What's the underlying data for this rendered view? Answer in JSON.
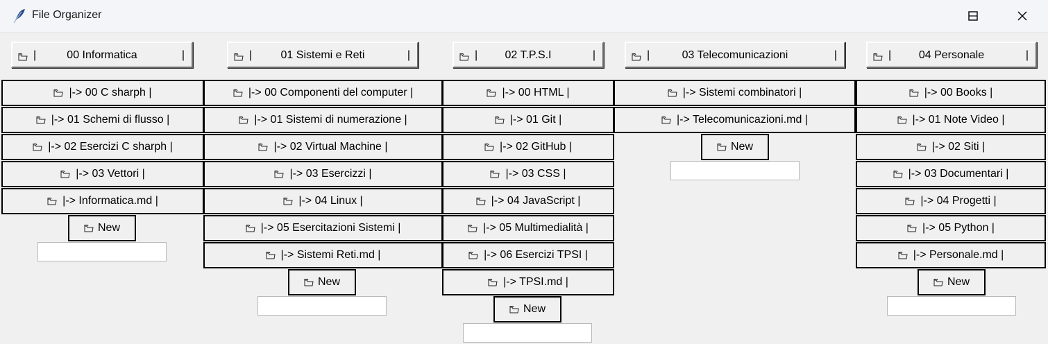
{
  "window": {
    "title": "File Organizer"
  },
  "columns": [
    {
      "folder": "00 Informatica",
      "items": [
        "|-> 00 C sharph |",
        "|-> 01 Schemi di flusso |",
        "|-> 02 Esercizi C sharph |",
        "|-> 03 Vettori |",
        "|-> Informatica.md |"
      ],
      "new_label": "New",
      "new_input": ""
    },
    {
      "folder": "01 Sistemi e Reti",
      "items": [
        "|-> 00 Componenti del computer |",
        "|-> 01 Sistemi di numerazione |",
        "|-> 02 Virtual Machine |",
        "|-> 03 Esercizzi |",
        "|-> 04 Linux |",
        "|-> 05 Esercitazioni Sistemi |",
        "|-> Sistemi Reti.md |"
      ],
      "new_label": "New",
      "new_input": ""
    },
    {
      "folder": "02 T.P.S.I",
      "items": [
        "|-> 00 HTML |",
        "|-> 01 Git |",
        "|-> 02 GitHub |",
        "|-> 03 CSS |",
        "|-> 04 JavaScript |",
        "|-> 05 Multimedialità |",
        "|-> 06 Esercizi TPSI |",
        "|-> TPSI.md |"
      ],
      "new_label": "New",
      "new_input": ""
    },
    {
      "folder": "03 Telecomunicazioni",
      "items": [
        "|-> Sistemi combinatori |",
        "|-> Telecomunicazioni.md |"
      ],
      "new_label": "New",
      "new_input": ""
    },
    {
      "folder": "04 Personale",
      "items": [
        "|-> 00 Books |",
        "|-> 01 Note  Video |",
        "|-> 02 Siti |",
        "|-> 03 Documentari |",
        "|-> 04 Progetti |",
        "|-> 05 Python |",
        "|-> Personale.md |"
      ],
      "new_label": "New",
      "new_input": ""
    }
  ],
  "icons": {
    "app": "feather-icon",
    "folder": "folder-icon"
  }
}
